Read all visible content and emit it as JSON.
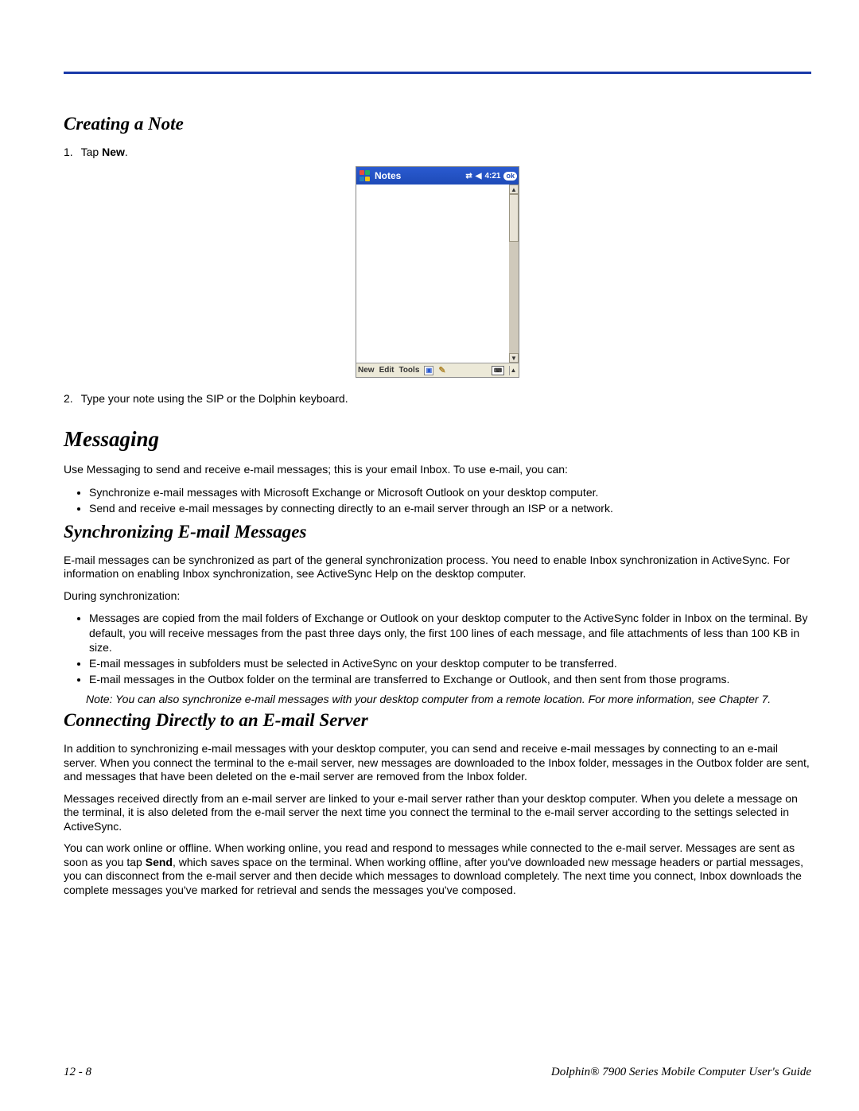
{
  "section_creating": {
    "heading": "Creating a Note",
    "step1_num": "1.",
    "step1_pre": "Tap ",
    "step1_bold": "New",
    "step1_post": ".",
    "step2_num": "2.",
    "step2_text": "Type your note using the SIP or the Dolphin keyboard."
  },
  "device": {
    "title": "Notes",
    "time": "4:21",
    "ok": "ok",
    "menu_new": "New",
    "menu_edit": "Edit",
    "menu_tools": "Tools"
  },
  "messaging": {
    "heading": "Messaging",
    "intro": "Use Messaging to send and receive e-mail messages; this is your email Inbox. To use e-mail, you can:",
    "bullets": [
      "Synchronize e-mail messages with Microsoft Exchange or Microsoft Outlook on your desktop computer.",
      "Send and receive e-mail messages by connecting directly to an e-mail server through an ISP or a network."
    ]
  },
  "sync": {
    "heading": "Synchronizing E-mail Messages",
    "p1": "E-mail messages can be synchronized as part of the general synchronization process. You need to enable Inbox synchronization in ActiveSync. For information on enabling Inbox synchronization, see ActiveSync Help on the desktop computer.",
    "p2": "During synchronization:",
    "bullets": [
      "Messages are copied from the mail folders of Exchange or Outlook on your desktop computer to the ActiveSync folder in Inbox on the terminal. By default, you will receive messages from the past three days only, the first 100 lines of each message, and file attachments of less than 100 KB in size.",
      "E-mail messages in subfolders must be selected in ActiveSync on your desktop computer to be transferred.",
      "E-mail messages in the Outbox folder on the terminal are transferred to Exchange or Outlook, and then sent from those programs."
    ],
    "note_label": "Note:",
    "note_text": "You can also synchronize e-mail messages with your desktop computer from a remote location. For more information, see Chapter 7."
  },
  "connect": {
    "heading": "Connecting Directly to an E-mail Server",
    "p1": "In addition to synchronizing e-mail messages with your desktop computer, you can send and receive e-mail messages by connecting to an e-mail server. When you connect the terminal to the e-mail server, new messages are downloaded to the Inbox folder, messages in the Outbox folder are sent, and messages that have been deleted on the e-mail server are removed from the Inbox folder.",
    "p2": "Messages received directly from an e-mail server are linked to your e-mail server rather than your desktop computer. When you delete a message on the terminal, it is also deleted from the e-mail server the next time you connect the terminal to the e-mail server according to the settings selected in ActiveSync.",
    "p3_pre": "You can work online or offline. When working online, you read and respond to messages while connected to the e-mail server. Messages are sent as soon as you tap ",
    "p3_bold": "Send",
    "p3_post": ", which saves space on the terminal. When working offline, after you've downloaded new message headers or partial messages, you can disconnect from the e-mail server and then decide which messages to download completely. The next time you connect, Inbox downloads the complete messages you've marked for retrieval and sends the messages you've composed."
  },
  "footer": {
    "page": "12 - 8",
    "title": "Dolphin® 7900 Series Mobile Computer User's Guide"
  }
}
